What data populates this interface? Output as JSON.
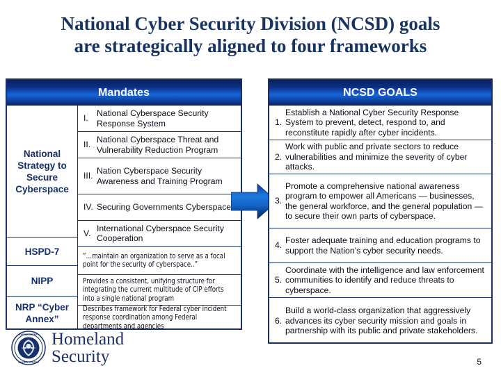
{
  "title": {
    "line1": "National Cyber Security Division (NCSD) goals",
    "line2": "are strategically aligned to four frameworks"
  },
  "colors": {
    "title_navy": "#173461",
    "header_blue_dark": "#0b1f57",
    "header_blue_bright": "#1565d8",
    "border_navy": "#17306b",
    "arrow_blue": "#1763c8",
    "logo_navy": "#1b2f61"
  },
  "mandates_panel": {
    "header": "Mandates",
    "frameworks": [
      {
        "id": "nsss",
        "label": "National Strategy to Secure Cyberspace"
      },
      {
        "id": "hspd7",
        "label": "HSPD-7"
      },
      {
        "id": "nipp",
        "label": "NIPP"
      },
      {
        "id": "nrp",
        "label": "NRP “Cyber Annex”"
      }
    ],
    "items": [
      {
        "num": "I.",
        "text": "National Cyberspace Security Response System"
      },
      {
        "num": "II.",
        "text": "National Cyberspace Threat and Vulnerability Reduction Program"
      },
      {
        "num": "III.",
        "text": "Nation Cyberspace Security Awareness and Training Program"
      },
      {
        "num": "IV.",
        "text": "Securing Governments Cyberspace"
      },
      {
        "num": "V.",
        "text": "International Cyberspace Security Cooperation"
      },
      {
        "num": "",
        "text": "“…maintain an organization to serve as a focal point for the security of cyberspace..”"
      },
      {
        "num": "",
        "text": "Provides a consistent, unifying structure for integrating the current multitude of CIP efforts into a single national program"
      },
      {
        "num": "",
        "text": "Describes framework for Federal cyber incident response coordination among Federal departments and agencies"
      }
    ]
  },
  "goals_panel": {
    "header": "NCSD GOALS",
    "items": [
      {
        "num": "1.",
        "text": "Establish a National Cyber Security Response System to prevent, detect, respond to, and reconstitute rapidly after cyber incidents."
      },
      {
        "num": "2.",
        "text": "Work with public and private sectors to reduce vulnerabilities and minimize the severity of cyber attacks."
      },
      {
        "num": "3.",
        "text": "Promote a comprehensive national awareness program to empower all Americans — businesses, the general workforce, and the general population — to secure their own parts of cyberspace."
      },
      {
        "num": "4.",
        "text": "Foster adequate training and education programs to support the Nation’s cyber security needs."
      },
      {
        "num": "5.",
        "text": "Coordinate with the intelligence and law enforcement communities to identify and reduce threats to cyberspace."
      },
      {
        "num": "6.",
        "text": "Build a world-class organization that aggressively advances its cyber security mission and goals in partnership with its public and private stakeholders."
      }
    ]
  },
  "logo": {
    "wordmark_line1": "Homeland",
    "wordmark_line2": "Security",
    "seal_top_text": "DEPARTMENT",
    "seal_bottom_text": "UNITED STATES"
  },
  "page_number": "5"
}
